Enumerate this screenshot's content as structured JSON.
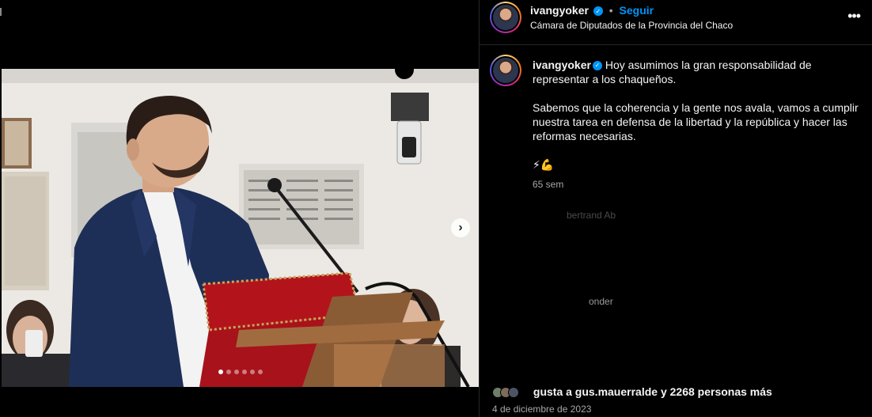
{
  "post": {
    "username": "ivangyoker",
    "separator": "•",
    "follow_label": "Seguir",
    "location": "Cámara de Diputados de la Provincia del Chaco",
    "more_icon": "more-horizontal-icon",
    "caption_line1": "Hoy asumimos la gran responsabilidad de representar a los chaqueños.",
    "caption_line2": "Sabemos que la coherencia y la gente nos avala, vamos a cumplir nuestra tarea en defensa de la libertad y la república y hacer las reformas necesarias.",
    "caption_emojis": "⚡💪",
    "time_ago": "65 sem",
    "likes_text": "gusta a gus.mauerralde y 2268 personas más",
    "date": "4 de diciembre de 2023"
  },
  "media": {
    "next_icon": "chevron-right-icon",
    "carousel_count": 6,
    "carousel_active": 0,
    "next_glyph": "›"
  },
  "comments_ghost": {
    "line1": "bertrand Ab",
    "line2": "onder"
  },
  "colors": {
    "accent": "#0095f6",
    "background": "#000000",
    "muted": "#a8a8a8"
  }
}
